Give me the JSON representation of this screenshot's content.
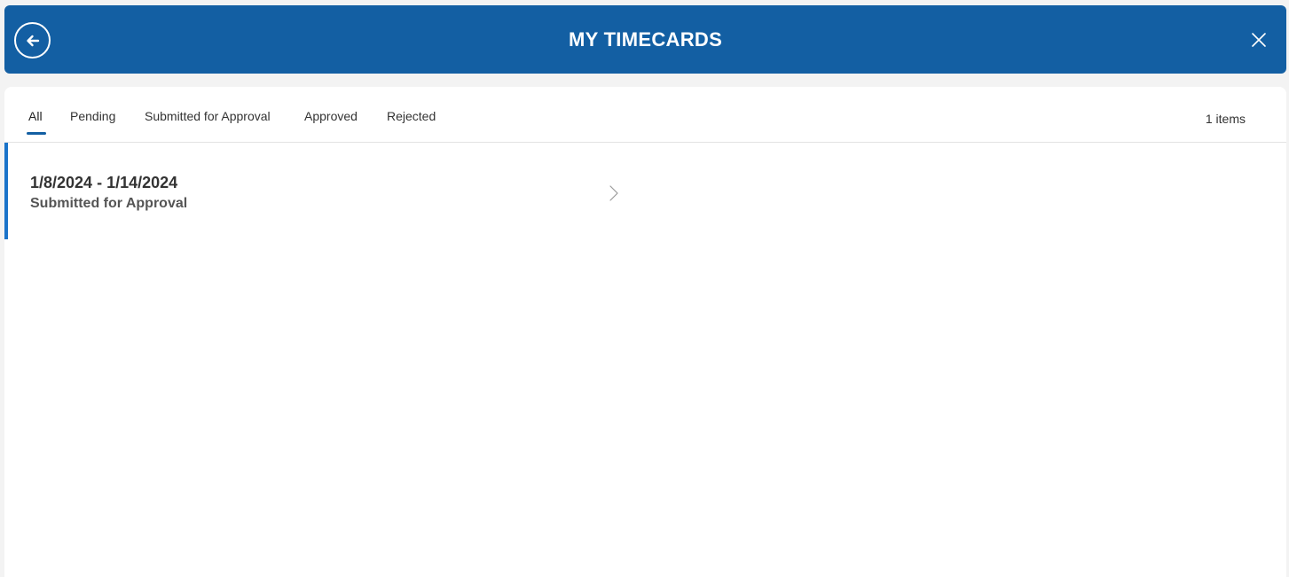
{
  "header": {
    "title": "MY TIMECARDS",
    "back_icon": "arrow-left-circle-icon",
    "close_icon": "close-icon",
    "color": "#135fa3"
  },
  "tabs": [
    {
      "label": "All",
      "active": true
    },
    {
      "label": "Pending",
      "active": false
    },
    {
      "label": "Submitted for Approval",
      "active": false
    },
    {
      "label": "Approved",
      "active": false
    },
    {
      "label": "Rejected",
      "active": false
    }
  ],
  "item_count": "1 items",
  "timecards": [
    {
      "date_range": "1/8/2024 - 1/14/2024",
      "status": "Submitted for Approval",
      "icon": "chevron-right-icon"
    }
  ],
  "accent_color": "#1a73c9"
}
